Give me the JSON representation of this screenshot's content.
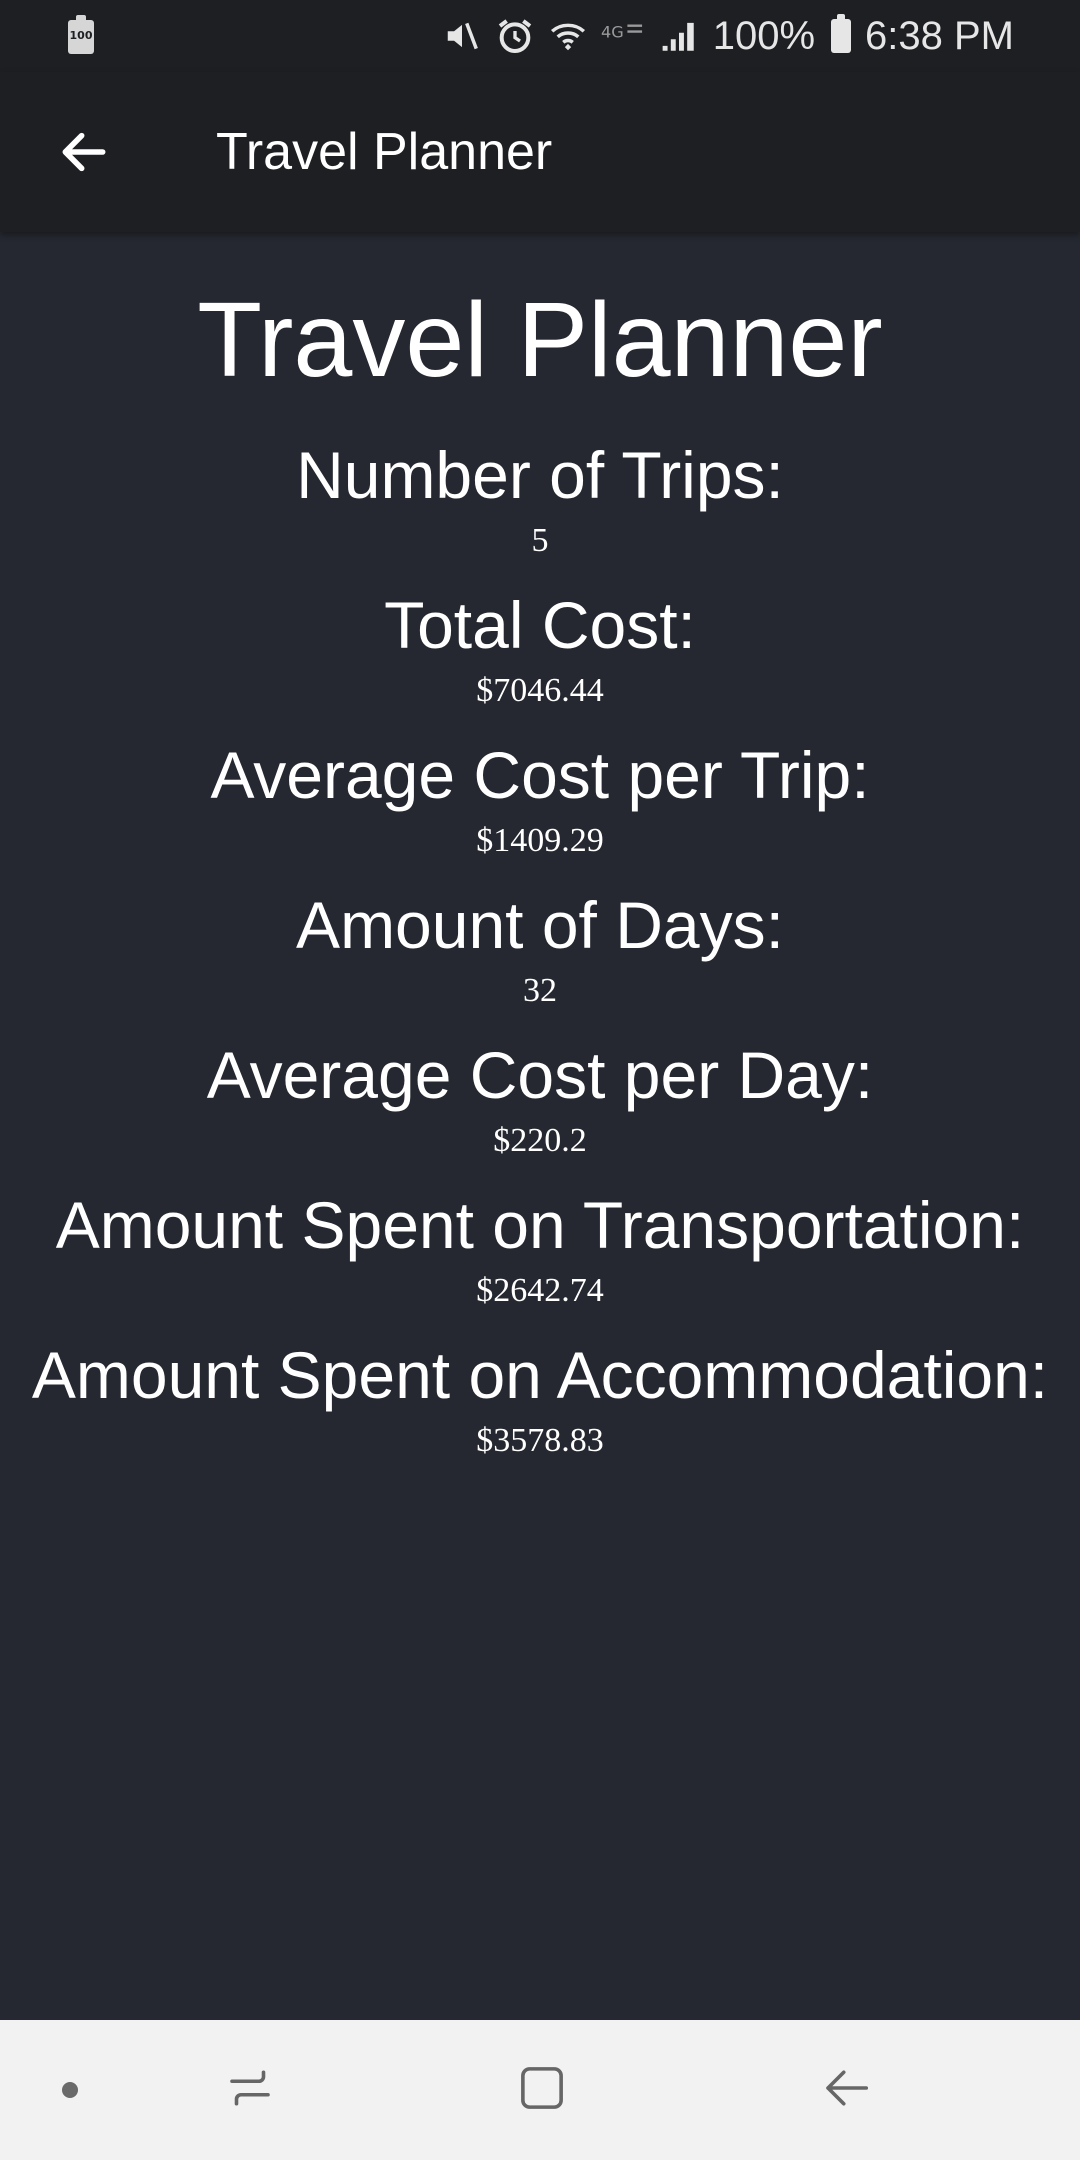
{
  "status_bar": {
    "left_battery_text": "100",
    "battery_percent": "100%",
    "time": "6:38 PM",
    "icons": [
      "mute-icon",
      "alarm-icon",
      "wifi-icon",
      "lte-icon",
      "signal-icon",
      "battery-icon"
    ]
  },
  "app_bar": {
    "title": "Travel Planner",
    "back_icon": "arrow-left-icon"
  },
  "page": {
    "title": "Travel Planner",
    "stats": [
      {
        "label": "Number of Trips:",
        "value": "5"
      },
      {
        "label": "Total Cost:",
        "value": "$7046.44"
      },
      {
        "label": "Average Cost per Trip:",
        "value": "$1409.29"
      },
      {
        "label": "Amount of Days:",
        "value": "32"
      },
      {
        "label": "Average Cost per Day:",
        "value": "$220.2"
      },
      {
        "label": "Amount Spent on Transportation:",
        "value": "$2642.74"
      },
      {
        "label": "Amount Spent on Accommodation:",
        "value": "$3578.83"
      }
    ]
  },
  "nav_bar": {
    "items": [
      "dot-icon",
      "recent-apps-icon",
      "home-icon",
      "back-icon"
    ]
  },
  "colors": {
    "background": "#252830",
    "app_bar": "#1d1f23",
    "text": "#ffffff",
    "nav_bar": "#f2f2f2"
  }
}
